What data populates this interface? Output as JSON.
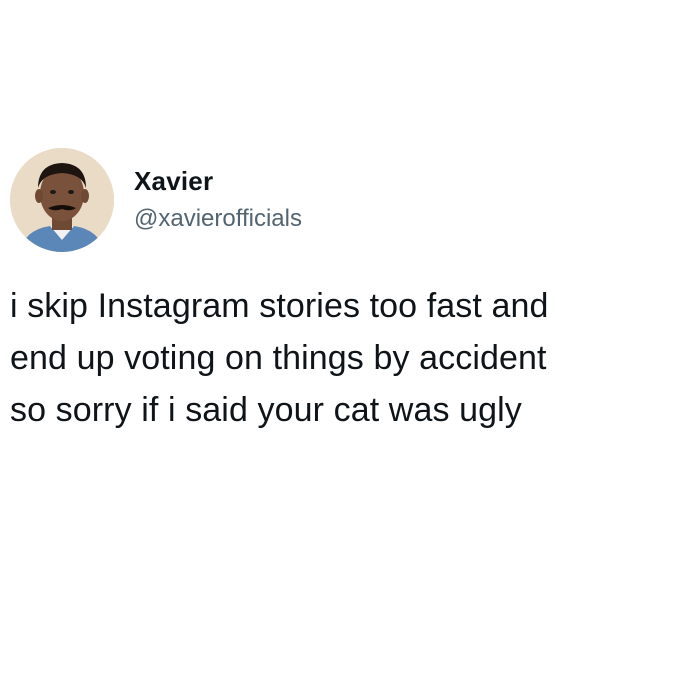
{
  "author": {
    "display_name": "Xavier",
    "handle": "@xavierofficials",
    "avatar_icon": "user-avatar-photo"
  },
  "tweet": {
    "lines": [
      "i skip Instagram stories too fast and",
      "end up voting on things by accident",
      "so sorry if i said your cat was ugly"
    ]
  },
  "colors": {
    "text_primary": "#0f1419",
    "text_secondary": "#536471",
    "background": "#ffffff"
  }
}
